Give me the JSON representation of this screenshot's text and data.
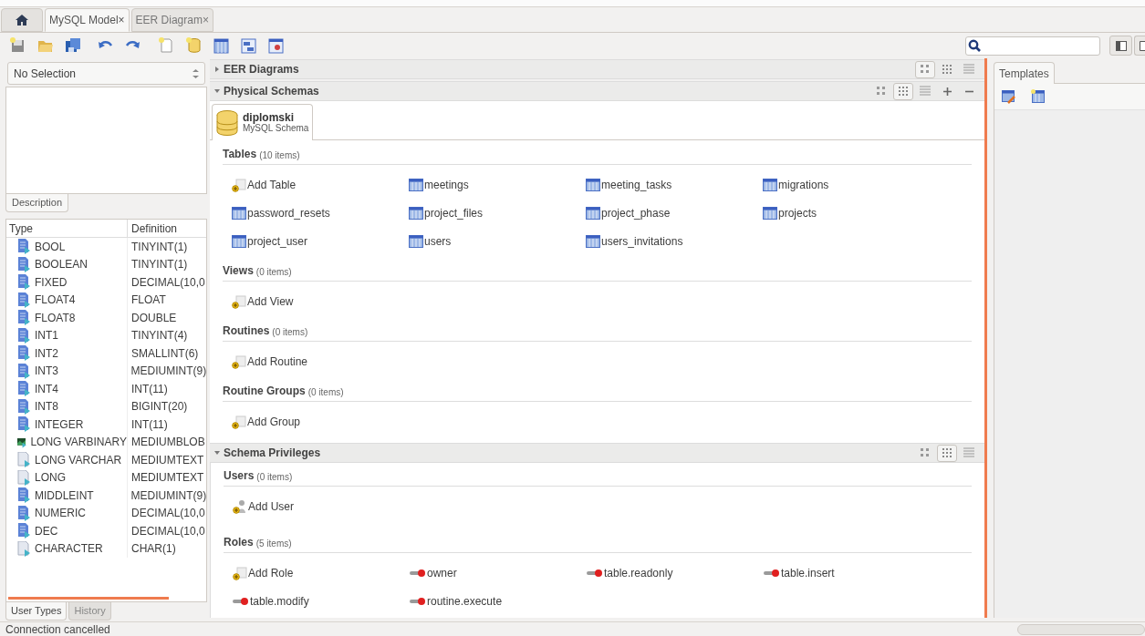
{
  "tabs": [
    {
      "label": "MySQL Model",
      "close": "×",
      "selected": true
    },
    {
      "label": "EER Diagram",
      "close": "×",
      "selected": false
    }
  ],
  "left_panel": {
    "selector": "No Selection",
    "description_tab": "Description",
    "columns": [
      "Type",
      "Definition"
    ],
    "rows": [
      {
        "type": "BOOL",
        "definition": "TINYINT(1)",
        "kind": "number"
      },
      {
        "type": "BOOLEAN",
        "definition": "TINYINT(1)",
        "kind": "number"
      },
      {
        "type": "FIXED",
        "definition": "DECIMAL(10,0",
        "kind": "number"
      },
      {
        "type": "FLOAT4",
        "definition": "FLOAT",
        "kind": "number"
      },
      {
        "type": "FLOAT8",
        "definition": "DOUBLE",
        "kind": "number"
      },
      {
        "type": "INT1",
        "definition": "TINYINT(4)",
        "kind": "number"
      },
      {
        "type": "INT2",
        "definition": "SMALLINT(6)",
        "kind": "number"
      },
      {
        "type": "INT3",
        "definition": "MEDIUMINT(9)",
        "kind": "number"
      },
      {
        "type": "INT4",
        "definition": "INT(11)",
        "kind": "number"
      },
      {
        "type": "INT8",
        "definition": "BIGINT(20)",
        "kind": "number"
      },
      {
        "type": "INTEGER",
        "definition": "INT(11)",
        "kind": "number"
      },
      {
        "type": "LONG VARBINARY",
        "definition": "MEDIUMBLOB",
        "kind": "blob"
      },
      {
        "type": "LONG VARCHAR",
        "definition": "MEDIUMTEXT",
        "kind": "text"
      },
      {
        "type": "LONG",
        "definition": "MEDIUMTEXT",
        "kind": "text"
      },
      {
        "type": "MIDDLEINT",
        "definition": "MEDIUMINT(9)",
        "kind": "number"
      },
      {
        "type": "NUMERIC",
        "definition": "DECIMAL(10,0",
        "kind": "number"
      },
      {
        "type": "DEC",
        "definition": "DECIMAL(10,0",
        "kind": "number"
      },
      {
        "type": "CHARACTER",
        "definition": "CHAR(1)",
        "kind": "text"
      }
    ],
    "bottom_tabs": [
      {
        "label": "User Types",
        "selected": true
      },
      {
        "label": "History",
        "selected": false
      }
    ]
  },
  "sections": [
    {
      "title": "EER Diagrams",
      "expanded": false,
      "view_buttons": [
        {
          "kind": "large",
          "selected": true
        },
        {
          "kind": "medium",
          "selected": false
        },
        {
          "kind": "list",
          "selected": false
        }
      ]
    },
    {
      "title": "Physical Schemas",
      "expanded": true,
      "view_buttons": [
        {
          "kind": "large",
          "selected": false
        },
        {
          "kind": "medium",
          "selected": true
        },
        {
          "kind": "list",
          "selected": false
        }
      ],
      "add_remove": true,
      "schema": {
        "name": "diplomski",
        "subtitle": "MySQL Schema"
      },
      "groups": [
        {
          "title": "Tables",
          "count": "(10 items)",
          "items": [
            {
              "label": "Add Table",
              "kind": "add"
            },
            {
              "label": "meetings",
              "kind": "table"
            },
            {
              "label": "meeting_tasks",
              "kind": "table"
            },
            {
              "label": "migrations",
              "kind": "table"
            },
            {
              "label": "password_resets",
              "kind": "table"
            },
            {
              "label": "project_files",
              "kind": "table"
            },
            {
              "label": "project_phase",
              "kind": "table"
            },
            {
              "label": "projects",
              "kind": "table"
            },
            {
              "label": "project_user",
              "kind": "table"
            },
            {
              "label": "users",
              "kind": "table"
            },
            {
              "label": "users_invitations",
              "kind": "table"
            }
          ]
        },
        {
          "title": "Views",
          "count": "(0 items)",
          "items": [
            {
              "label": "Add View",
              "kind": "add"
            }
          ]
        },
        {
          "title": "Routines",
          "count": "(0 items)",
          "items": [
            {
              "label": "Add Routine",
              "kind": "add"
            }
          ]
        },
        {
          "title": "Routine Groups",
          "count": "(0 items)",
          "items": [
            {
              "label": "Add Group",
              "kind": "add"
            }
          ]
        }
      ]
    },
    {
      "title": "Schema Privileges",
      "expanded": true,
      "view_buttons": [
        {
          "kind": "large",
          "selected": false
        },
        {
          "kind": "medium",
          "selected": true
        },
        {
          "kind": "list",
          "selected": false
        }
      ],
      "groups": [
        {
          "title": "Users",
          "count": "(0 items)",
          "items": [
            {
              "label": "Add User",
              "kind": "add_user"
            }
          ]
        },
        {
          "title": "Roles",
          "count": "(5 items)",
          "items": [
            {
              "label": "Add Role",
              "kind": "add"
            },
            {
              "label": "owner",
              "kind": "role"
            },
            {
              "label": "table.readonly",
              "kind": "role"
            },
            {
              "label": "table.insert",
              "kind": "role"
            },
            {
              "label": "table.modify",
              "kind": "role"
            },
            {
              "label": "routine.execute",
              "kind": "role"
            }
          ]
        }
      ]
    }
  ],
  "templates_tab": "Templates",
  "status": "Connection cancelled"
}
